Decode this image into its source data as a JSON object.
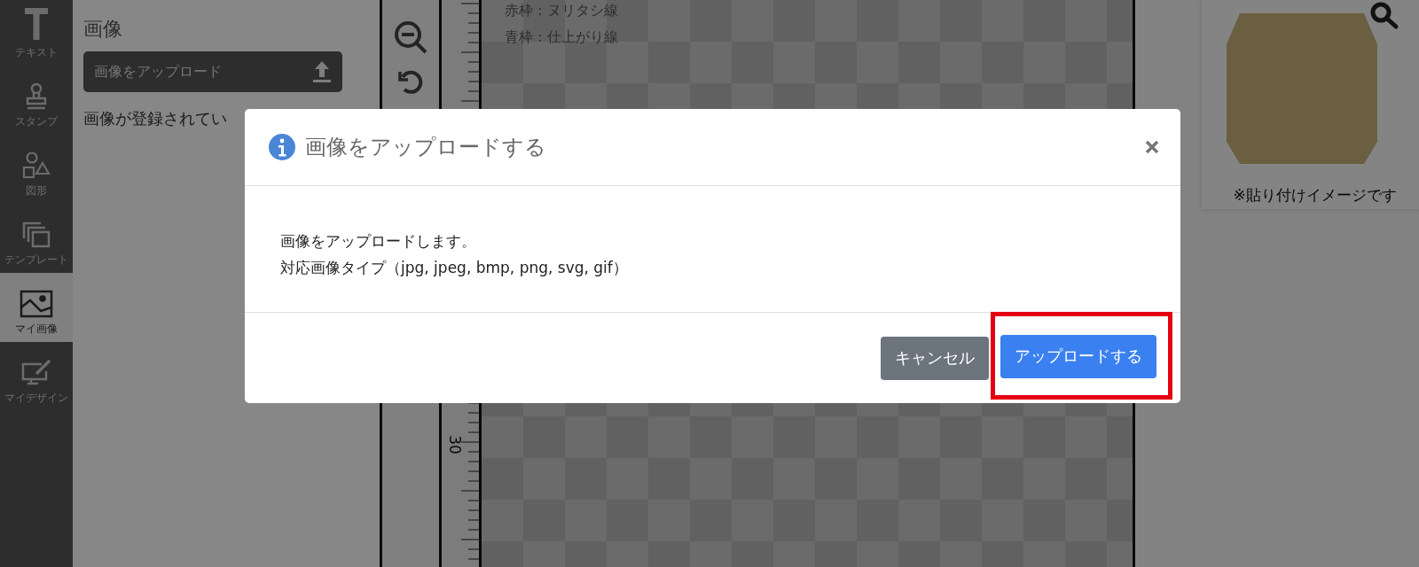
{
  "sidebar": {
    "items": [
      {
        "kind": "text",
        "label": "テキスト",
        "selected": false
      },
      {
        "kind": "stamp",
        "label": "スタンプ",
        "selected": false
      },
      {
        "kind": "shapes",
        "label": "図形",
        "selected": false
      },
      {
        "kind": "template",
        "label": "テンプレート",
        "selected": false
      },
      {
        "kind": "image",
        "label": "マイ画像",
        "selected": true
      },
      {
        "kind": "design",
        "label": "マイデザイン",
        "selected": false
      }
    ]
  },
  "panel": {
    "title": "画像",
    "upload_button": "画像をアップロード",
    "message": "画像が登録されてい"
  },
  "canvas": {
    "notes": [
      "赤枠：ヌリタシ線",
      "青枠：仕上がり線"
    ],
    "ruler_label": "30"
  },
  "preview": {
    "caption": "※貼り付けイメージです"
  },
  "dialog": {
    "title": "画像をアップロードする",
    "lines": [
      "画像をアップロードします。",
      "対応画像タイプ（jpg, jpeg, bmp, png, svg, gif）"
    ],
    "buttons": [
      {
        "kind": "secondary",
        "label": "キャンセル",
        "highlighted": false
      },
      {
        "kind": "primary",
        "label": "アップロードする",
        "highlighted": true
      }
    ]
  }
}
